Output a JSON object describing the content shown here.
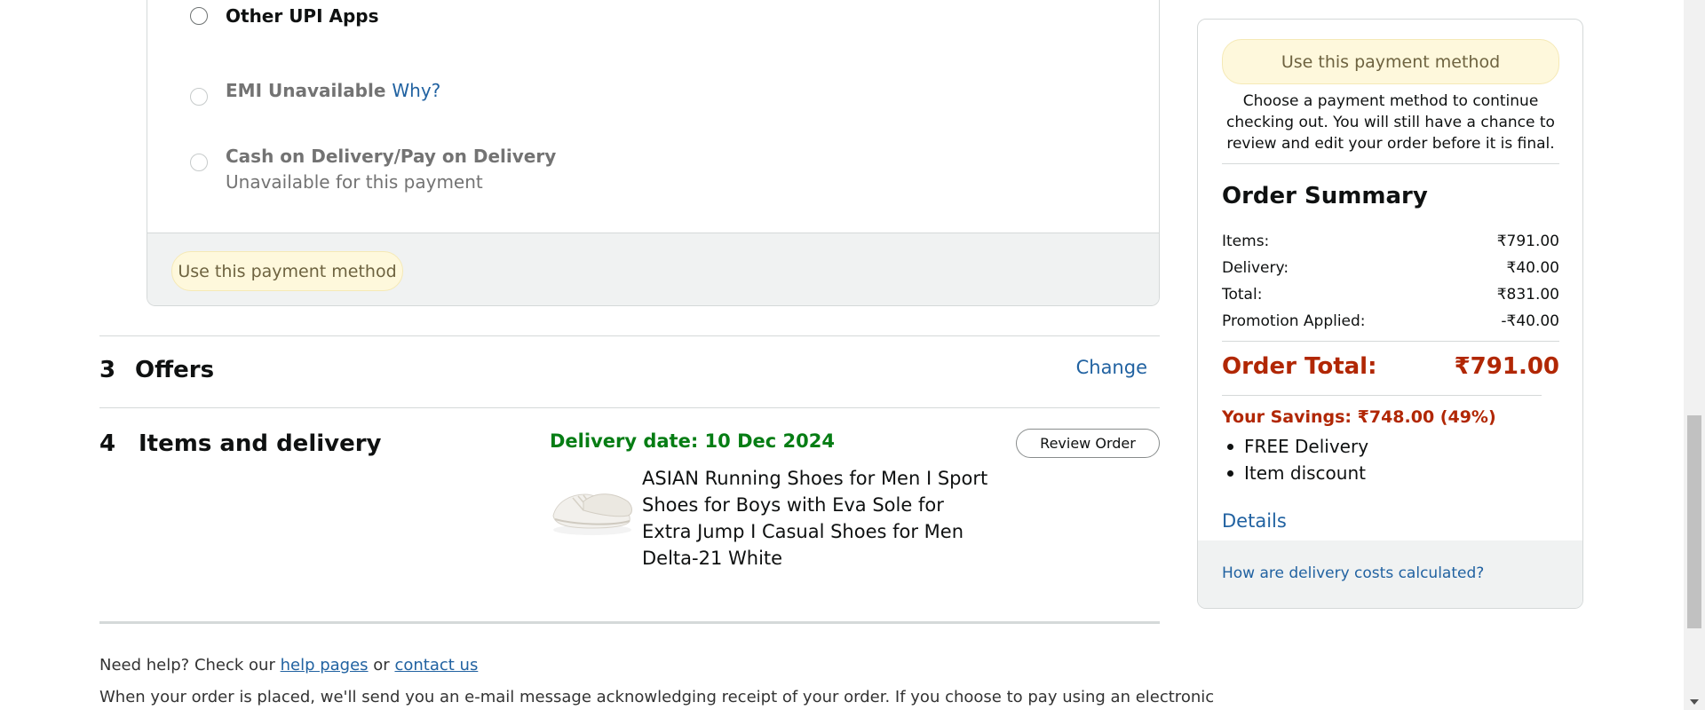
{
  "payment": {
    "options": [
      {
        "label": "Other UPI Apps"
      },
      {
        "label": "EMI Unavailable",
        "link": "Why?"
      },
      {
        "label": "Cash on Delivery/Pay on Delivery",
        "sub": "Unavailable for this payment"
      }
    ],
    "use_button": "Use this payment method"
  },
  "sections": {
    "offers": {
      "num": "3",
      "title": "Offers",
      "action": "Change"
    },
    "items": {
      "num": "4",
      "title": "Items and delivery"
    }
  },
  "delivery": {
    "date": "Delivery date: 10 Dec 2024",
    "review_button": "Review Order",
    "product_name": "ASIAN Running Shoes for Men I Sport Shoes for Boys with Eva Sole for Extra Jump I Casual Shoes for Men Delta-21 White"
  },
  "footer": {
    "help_prefix": "Need help? Check our",
    "help_link": "help pages",
    "or": "or",
    "contact_link": "contact us",
    "notice": "When your order is placed, we'll send you an e-mail message acknowledging receipt of your order. If you choose to pay using an electronic"
  },
  "sidebar": {
    "use_button": "Use this payment method",
    "note": "Choose a payment method to continue checking out. You will still have a chance to review and edit your order before it is final.",
    "summary_title": "Order Summary",
    "rows": [
      {
        "label": "Items:",
        "value": "₹791.00"
      },
      {
        "label": "Delivery:",
        "value": "₹40.00"
      },
      {
        "label": "Total:",
        "value": "₹831.00"
      },
      {
        "label": "Promotion Applied:",
        "value": "-₹40.00"
      }
    ],
    "order_total_label": "Order Total:",
    "order_total_value": "₹791.00",
    "savings": "Your Savings: ₹748.00 (49%)",
    "bullets": [
      "FREE Delivery",
      "Item discount"
    ],
    "details": "Details",
    "delivery_costs_link": "How are delivery costs calculated?"
  },
  "colors": {
    "accent": "#2162a1",
    "price": "#b12704",
    "delivery": "#067d14",
    "button": "#fef8dc"
  }
}
